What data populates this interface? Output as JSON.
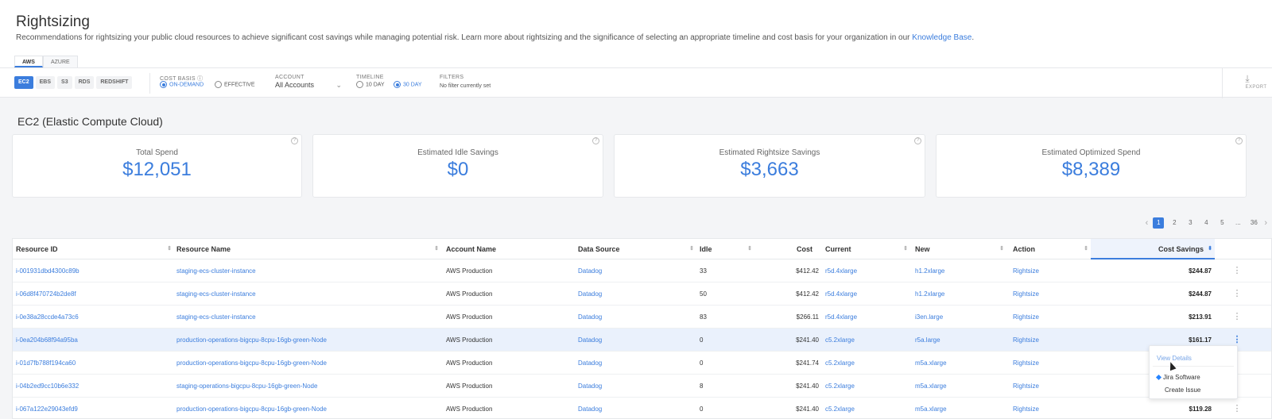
{
  "page": {
    "title": "Rightsizing",
    "description": "Recommendations for rightsizing your public cloud resources to achieve significant cost savings while managing potential risk. Learn more about rightsizing and the significance of selecting an appropriate timeline and cost basis for your organization in our ",
    "kb_link": "Knowledge Base",
    "kb_suffix": "."
  },
  "cloud_tabs": [
    "AWS",
    "AZURE"
  ],
  "service_tabs": [
    "EC2",
    "EBS",
    "S3",
    "RDS",
    "REDSHIFT"
  ],
  "toolbar": {
    "cost_basis_label": "COST BASIS",
    "cost_basis_options": [
      "ON-DEMAND",
      "EFFECTIVE"
    ],
    "account_label": "ACCOUNT",
    "account_value": "All Accounts",
    "timeline_label": "TIMELINE",
    "timeline_options": [
      "10 DAY",
      "30 DAY"
    ],
    "filters_label": "FILTERS",
    "filters_value": "No filter currently set",
    "export_label": "EXPORT"
  },
  "section": {
    "title": "EC2 (Elastic Compute Cloud)"
  },
  "cards": [
    {
      "label": "Total Spend",
      "value": "$12,051"
    },
    {
      "label": "Estimated Idle Savings",
      "value": "$0"
    },
    {
      "label": "Estimated Rightsize Savings",
      "value": "$3,663"
    },
    {
      "label": "Estimated Optimized Spend",
      "value": "$8,389"
    }
  ],
  "pager": {
    "pages": [
      "1",
      "2",
      "3",
      "4",
      "5",
      "...",
      "36"
    ]
  },
  "table": {
    "columns": [
      "Resource ID",
      "Resource Name",
      "Account Name",
      "Data Source",
      "Idle",
      "Cost",
      "Current",
      "New",
      "Action",
      "Cost Savings"
    ],
    "rows": [
      {
        "id": "i-001931dbd4300c89b",
        "name": "staging-ecs-cluster-instance",
        "account": "AWS Production",
        "source": "Datadog",
        "idle": "33",
        "cost": "$412.42",
        "current": "r5d.4xlarge",
        "new": "h1.2xlarge",
        "action": "Rightsize",
        "savings": "$244.87"
      },
      {
        "id": "i-06d8f470724b2de8f",
        "name": "staging-ecs-cluster-instance",
        "account": "AWS Production",
        "source": "Datadog",
        "idle": "50",
        "cost": "$412.42",
        "current": "r5d.4xlarge",
        "new": "h1.2xlarge",
        "action": "Rightsize",
        "savings": "$244.87"
      },
      {
        "id": "i-0e38a28ccde4a73c6",
        "name": "staging-ecs-cluster-instance",
        "account": "AWS Production",
        "source": "Datadog",
        "idle": "83",
        "cost": "$266.11",
        "current": "r5d.4xlarge",
        "new": "i3en.large",
        "action": "Rightsize",
        "savings": "$213.91"
      },
      {
        "id": "i-0ea204b68f94a95ba",
        "name": "production-operations-bigcpu-8cpu-16gb-green-Node",
        "account": "AWS Production",
        "source": "Datadog",
        "idle": "0",
        "cost": "$241.40",
        "current": "c5.2xlarge",
        "new": "r5a.large",
        "action": "Rightsize",
        "savings": "$161.17"
      },
      {
        "id": "i-01d7fb788f194ca60",
        "name": "production-operations-bigcpu-8cpu-16gb-green-Node",
        "account": "AWS Production",
        "source": "Datadog",
        "idle": "0",
        "cost": "$241.74",
        "current": "c5.2xlarge",
        "new": "m5a.xlarge",
        "action": "Rightsize",
        "savings": ""
      },
      {
        "id": "i-04b2ed9cc10b6e332",
        "name": "staging-operations-bigcpu-8cpu-16gb-green-Node",
        "account": "AWS Production",
        "source": "Datadog",
        "idle": "8",
        "cost": "$241.40",
        "current": "c5.2xlarge",
        "new": "m5a.xlarge",
        "action": "Rightsize",
        "savings": ""
      },
      {
        "id": "i-067a122e29043efd9",
        "name": "production-operations-bigcpu-8cpu-16gb-green-Node",
        "account": "AWS Production",
        "source": "Datadog",
        "idle": "0",
        "cost": "$241.40",
        "current": "c5.2xlarge",
        "new": "m5a.xlarge",
        "action": "Rightsize",
        "savings": "$119.28"
      }
    ]
  },
  "row_menu": {
    "items": [
      "View Details",
      "Jira Software",
      "Create Issue"
    ]
  },
  "colors": {
    "accent": "#3b7ddd",
    "highlight_row": "#eaf1fc"
  }
}
